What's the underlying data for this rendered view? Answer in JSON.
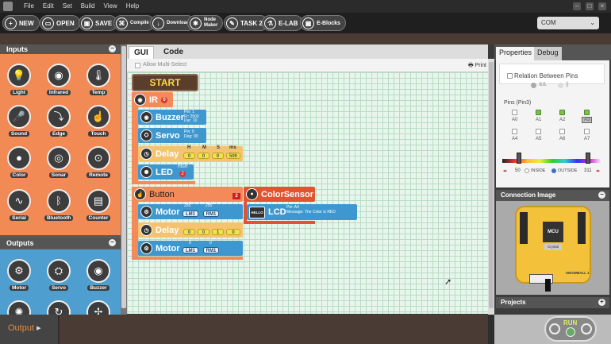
{
  "menu": {
    "file": "File",
    "edit": "Edit",
    "set": "Set",
    "build": "Build",
    "view": "View",
    "help": "Help"
  },
  "toolbar": {
    "new": "NEW",
    "open": "OPEN",
    "save": "SAVE",
    "compile": "Compile",
    "download": "Download",
    "node_maker_1": "Node",
    "node_maker_2": "Maker",
    "task2": "TASK 2",
    "elab": "E-LAB",
    "eblocks": "E-Blocks",
    "port": "COM"
  },
  "palette": {
    "inputs_title": "Inputs",
    "inputs": [
      "Light",
      "Infrared",
      "Temp",
      "Sound",
      "Edge",
      "Touch",
      "Color",
      "Sonar",
      "Remote",
      "Serial",
      "Bluetooth",
      "Counter"
    ],
    "outputs_title": "Outputs",
    "outputs": [
      "Motor",
      "Servo",
      "Buzzer"
    ]
  },
  "tabs": {
    "gui": "GUI",
    "code": "Code"
  },
  "canvas": {
    "allow_multi": "Allow Multi-Select",
    "print": "Print",
    "start": "START",
    "ir": "IR",
    "ir_badge": "0",
    "buzzer": "Buzzer",
    "buzzer_info": [
      "Pin: 1",
      "Fr: 2500",
      "Dur: 10"
    ],
    "servo": "Servo",
    "servo_info": [
      "Pin: 0",
      "Deg: 90"
    ],
    "delay1": "Delay",
    "delay1_vals": [
      "0",
      "0",
      "0",
      "500"
    ],
    "hms": [
      "H",
      "M",
      "S",
      "ms"
    ],
    "led": "LED",
    "led_info": "HIGH",
    "led_badge": "2",
    "button": "Button",
    "button_badge": "2",
    "motor1": "Motor",
    "motor1_vals": [
      "255",
      "255"
    ],
    "motor_lbls": [
      "LM1",
      "RM1"
    ],
    "delay2": "Delay",
    "delay2_vals": [
      "0",
      "0",
      "1",
      "0"
    ],
    "motor2": "Motor",
    "motor2_vals": [
      "0",
      "0"
    ],
    "color_sensor": "ColorSensor",
    "lcd": "LCD",
    "lcd_icon": "HELLO",
    "lcd_info": [
      "Pin: A4",
      "Message: The Color is RED"
    ]
  },
  "properties": {
    "tab_props": "Properties",
    "tab_debug": "Debug",
    "relation": "Relation Between Pins",
    "and": "&&",
    "or": "||",
    "pins_label": "Pins (Pin3)",
    "pins": [
      "A0",
      "A1",
      "A2",
      "A3",
      "A4",
      "A5",
      "A6",
      "A7"
    ],
    "pins_checked": [
      false,
      true,
      true,
      true,
      false,
      false,
      false,
      false
    ],
    "slider_low": "50",
    "inside": "INSIDE",
    "outside": "OUTSIDE",
    "slider_high": "311",
    "connection_image": "Connection Image",
    "board_mcu": "MCU",
    "board_crystal": "Crystal",
    "board_name": "SNOWBALL 1",
    "projects": "Projects"
  },
  "bottom": {
    "output": "Output",
    "run": "RUN"
  }
}
